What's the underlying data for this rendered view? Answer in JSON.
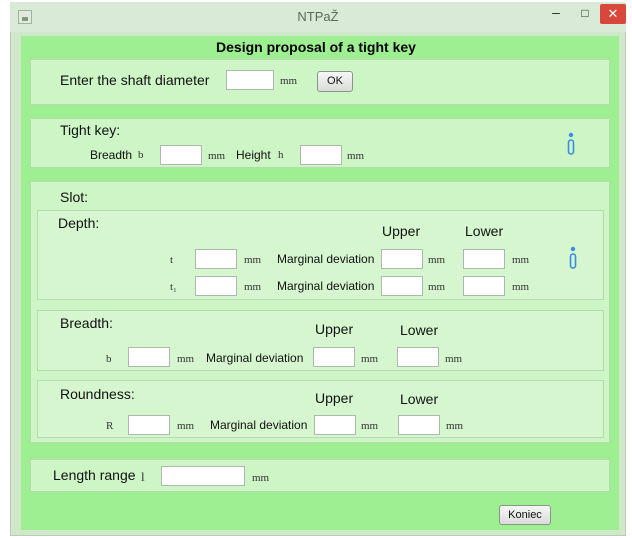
{
  "window": {
    "title": "NTPaŽ",
    "icons": {
      "app": "app-icon",
      "minimize": "minimize-icon",
      "maximize": "maximize-icon",
      "close": "close-icon"
    },
    "minimize_glyph": "–",
    "maximize_glyph": "□",
    "close_glyph": "✕"
  },
  "heading": "Design proposal of a tight key",
  "shaft": {
    "label": "Enter the shaft diameter",
    "unit": "mm",
    "ok_label": "OK",
    "value": ""
  },
  "tight_key": {
    "label": "Tight key:",
    "breadth_label": "Breadth",
    "breadth_symbol": "b",
    "breadth_value": "",
    "breadth_unit": "mm",
    "height_label": "Height",
    "height_symbol": "h",
    "height_value": "",
    "height_unit": "mm",
    "info_icon": "info-icon"
  },
  "slot": {
    "label": "Slot:",
    "depth": {
      "label": "Depth:",
      "upper": "Upper",
      "lower": "Lower",
      "info_icon": "info-icon",
      "rows": [
        {
          "symbol": "t",
          "unit": "mm",
          "dev_label": "Marginal deviation",
          "upper_unit": "mm",
          "lower_unit": "mm",
          "value": "",
          "upper_value": "",
          "lower_value": ""
        },
        {
          "symbol": "t₁",
          "unit": "mm",
          "dev_label": "Marginal deviation",
          "upper_unit": "mm",
          "lower_unit": "mm",
          "value": "",
          "upper_value": "",
          "lower_value": ""
        }
      ]
    },
    "breadth": {
      "label": "Breadth:",
      "upper": "Upper",
      "lower": "Lower",
      "symbol": "b",
      "unit": "mm",
      "dev_label": "Marginal deviation",
      "upper_unit": "mm",
      "lower_unit": "mm",
      "value": "",
      "upper_value": "",
      "lower_value": ""
    },
    "roundness": {
      "label": "Roundness:",
      "upper": "Upper",
      "lower": "Lower",
      "symbol": "R",
      "unit": "mm",
      "dev_label": "Marginal deviation",
      "upper_unit": "mm",
      "lower_unit": "mm",
      "value": "",
      "upper_value": "",
      "lower_value": ""
    }
  },
  "length": {
    "label": "Length range",
    "symbol": "l",
    "unit": "mm",
    "value": ""
  },
  "close_label": "Koniec"
}
